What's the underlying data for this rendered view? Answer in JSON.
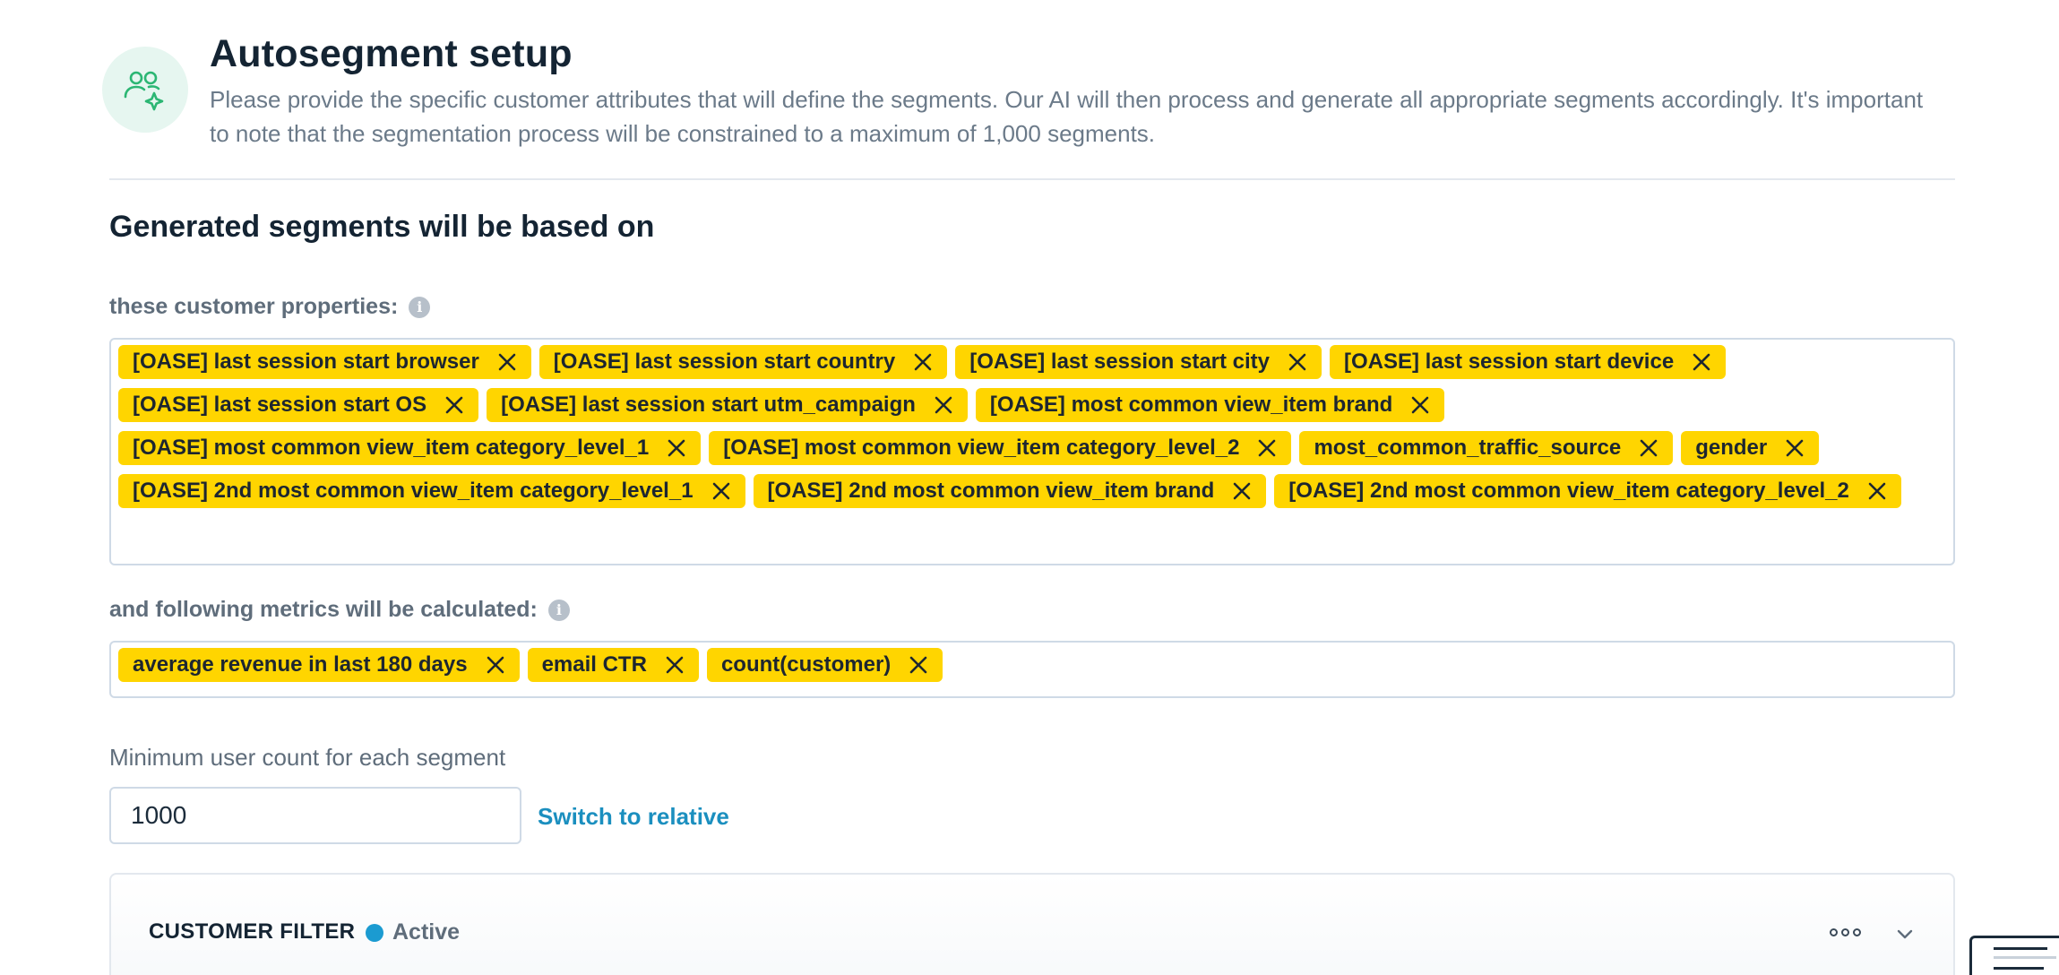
{
  "header": {
    "title": "Autosegment setup",
    "description": "Please provide the specific customer attributes that will define the segments. Our AI will then process and generate all appropriate segments accordingly. It's important to note that the segmentation process will be constrained to a maximum of 1,000 segments.",
    "icon": "users-sparkle-icon"
  },
  "section": {
    "title": "Generated segments will be based on"
  },
  "properties": {
    "label": "these customer properties:",
    "tags": [
      "[OASE] last session start browser",
      "[OASE] last session start country",
      "[OASE] last session start city",
      "[OASE] last session start device",
      "[OASE] last session start OS",
      "[OASE] last session start utm_campaign",
      "[OASE] most common view_item brand",
      "[OASE] most common view_item category_level_1",
      "[OASE] most common view_item category_level_2",
      "most_common_traffic_source",
      "gender",
      "[OASE] 2nd most common view_item category_level_1",
      "[OASE] 2nd most common view_item brand",
      "[OASE] 2nd most common view_item category_level_2"
    ]
  },
  "metrics": {
    "label": "and following metrics will be calculated:",
    "tags": [
      "average revenue in last 180 days",
      "email CTR",
      "count(customer)"
    ]
  },
  "min_count": {
    "label": "Minimum user count for each segment",
    "value": "1000",
    "switch_label": "Switch to relative"
  },
  "filter": {
    "title": "CUSTOMER FILTER",
    "status": "Active",
    "status_color": "#1b9bd1"
  },
  "colors": {
    "tag_bg": "#ffd500",
    "link": "#1b8fbf",
    "accent_icon": "#2bb673"
  }
}
